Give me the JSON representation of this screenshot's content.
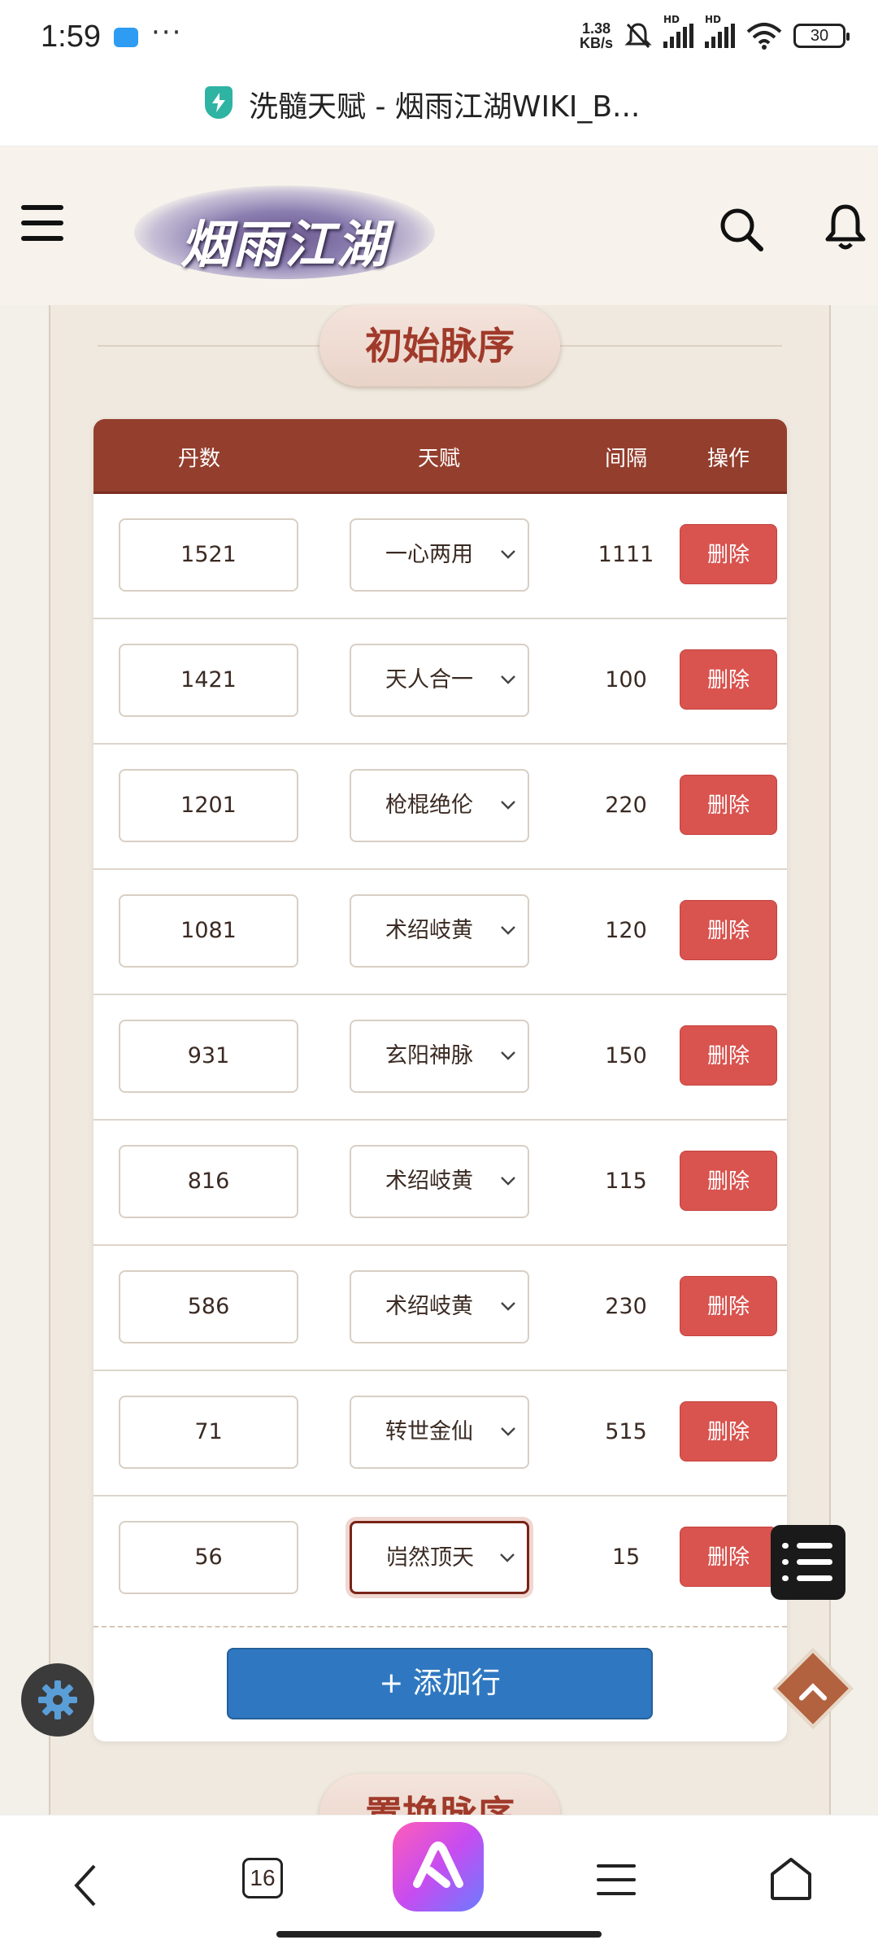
{
  "status": {
    "time": "1:59",
    "dots": "···",
    "netspeed_value": "1.38",
    "netspeed_unit": "KB/s",
    "hd1": "HD",
    "hd2": "HD",
    "battery": "30"
  },
  "browser": {
    "title": "洗髓天赋 - 烟雨江湖WIKI_B..."
  },
  "header": {
    "logo_text": "烟雨江湖"
  },
  "section": {
    "title": "初始脉序",
    "next_title": "置换脉序"
  },
  "table": {
    "headers": {
      "dan": "丹数",
      "talent": "天赋",
      "gap": "间隔",
      "action": "操作"
    },
    "delete_label": "删除",
    "rows": [
      {
        "dan": "1521",
        "talent": "一心两用",
        "gap": "1111"
      },
      {
        "dan": "1421",
        "talent": "天人合一",
        "gap": "100"
      },
      {
        "dan": "1201",
        "talent": "枪棍绝伦",
        "gap": "220"
      },
      {
        "dan": "1081",
        "talent": "术绍岐黄",
        "gap": "120"
      },
      {
        "dan": "931",
        "talent": "玄阳神脉",
        "gap": "150"
      },
      {
        "dan": "816",
        "talent": "术绍岐黄",
        "gap": "115"
      },
      {
        "dan": "586",
        "talent": "术绍岐黄",
        "gap": "230"
      },
      {
        "dan": "71",
        "talent": "转世金仙",
        "gap": "515"
      },
      {
        "dan": "56",
        "talent": "岿然顶天",
        "gap": "15"
      }
    ],
    "add_row_label": "+ 添加行"
  },
  "navbar": {
    "tab_count": "16"
  },
  "colors": {
    "header_bar": "#943e2d",
    "delete_button": "#d9534f",
    "add_button": "#2f78c1",
    "section_title": "#a03a2a"
  }
}
